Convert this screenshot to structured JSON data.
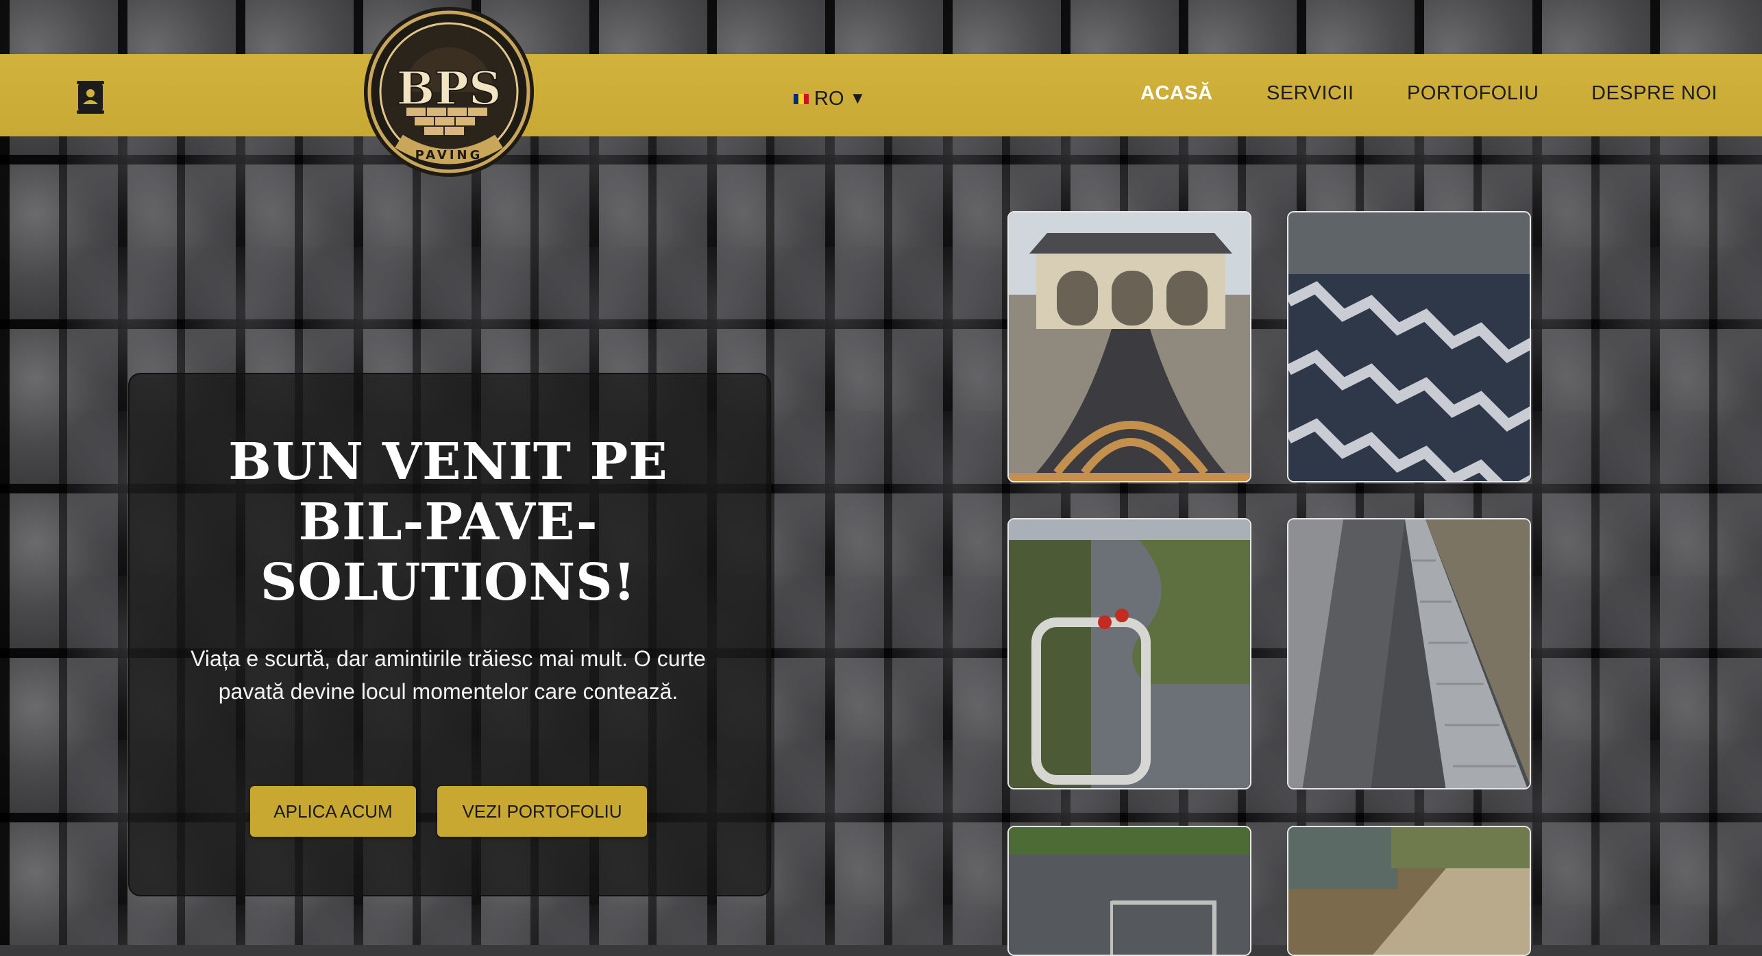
{
  "brand": {
    "logo_text": "BPS",
    "logo_sub": "PAVING",
    "accent": "#c9a935"
  },
  "header": {
    "contact_icon": "contact-card-icon",
    "language": {
      "code": "RO",
      "caret": "▼",
      "flag_colors": [
        "#002B7F",
        "#FCD116",
        "#CE1126"
      ]
    },
    "nav": [
      {
        "label": "ACASĂ",
        "active": true
      },
      {
        "label": "SERVICII",
        "active": false
      },
      {
        "label": "PORTOFOLIU",
        "active": false
      },
      {
        "label": "DESPRE NOI",
        "active": false
      }
    ]
  },
  "hero": {
    "title": "BUN VENIT PE BIL-PAVE-SOLUTIONS!",
    "subtitle": "Viața e scurtă, dar amintirile trăiesc mai mult. O curte pavată devine locul momentelor care contează.",
    "primary_button": "APLICA ACUM",
    "secondary_button": "VEZI PORTOFOLIU"
  },
  "gallery": [
    {
      "name": "gallery-photo-house-driveway"
    },
    {
      "name": "gallery-photo-zigzag-pavers"
    },
    {
      "name": "gallery-photo-garden-path"
    },
    {
      "name": "gallery-photo-stone-stairs"
    },
    {
      "name": "gallery-photo-parking-area"
    },
    {
      "name": "gallery-photo-walkway"
    }
  ]
}
